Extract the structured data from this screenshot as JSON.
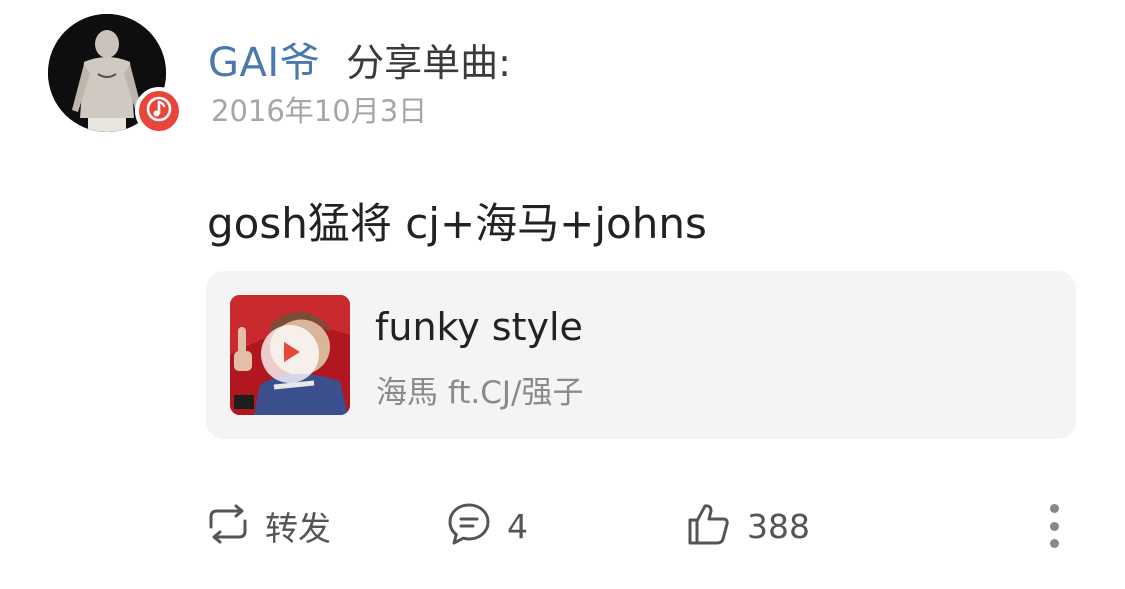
{
  "post": {
    "username": "GAI爷",
    "action_label": "分享单曲:",
    "date": "2016年10月3日",
    "text": "gosh猛将 cj+海马+johns"
  },
  "music_card": {
    "title": "funky style",
    "artist": "海馬 ft.CJ/强子"
  },
  "actions": {
    "repost_label": "转发",
    "comment_count": "4",
    "like_count": "388"
  },
  "colors": {
    "username": "#4a79ad",
    "music_badge": "#e8463b",
    "play_icon": "#e8463b",
    "album_background": "#b0171f"
  },
  "icons": {
    "badge": "music-note-icon",
    "play": "play-icon",
    "repost": "repost-icon",
    "comment": "comment-icon",
    "like": "thumbs-up-icon",
    "more": "more-vertical-icon"
  }
}
